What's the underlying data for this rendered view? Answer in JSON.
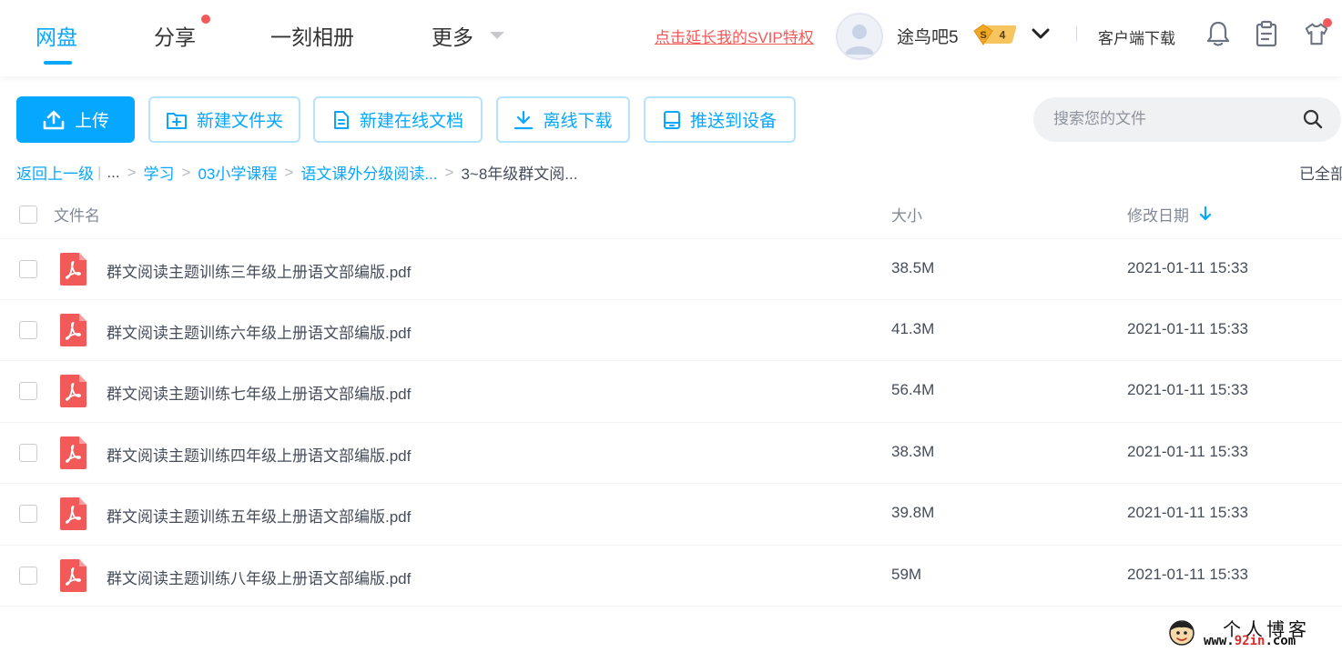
{
  "header": {
    "tabs": [
      {
        "label": "网盘",
        "active": true
      },
      {
        "label": "分享",
        "has_dot": true
      },
      {
        "label": "一刻相册"
      },
      {
        "label": "更多"
      }
    ],
    "svip_link": "点击延长我的SVIP特权",
    "username": "途鸟吧5",
    "vip_badge": {
      "symbol": "S",
      "level": "4"
    },
    "client_download": "客户端下载",
    "icons": [
      "bell-icon",
      "clipboard-icon",
      "tshirt-icon"
    ]
  },
  "toolbar": {
    "upload": "上传",
    "new_folder": "新建文件夹",
    "new_online_doc": "新建在线文档",
    "offline_download": "离线下载",
    "push_to_device": "推送到设备",
    "search_placeholder": "搜索您的文件"
  },
  "breadcrumb": {
    "back": "返回上一级",
    "ellipsis": "...",
    "items": [
      "学习",
      "03小学课程",
      "语文课外分级阅读..."
    ],
    "current": "3~8年级群文阅...",
    "loaded": "已全部"
  },
  "table": {
    "headers": {
      "name": "文件名",
      "size": "大小",
      "modified": "修改日期"
    },
    "sort": "modified-desc",
    "rows": [
      {
        "name": "群文阅读主题训练三年级上册语文部编版.pdf",
        "size": "38.5M",
        "date": "2021-01-11 15:33"
      },
      {
        "name": "群文阅读主题训练六年级上册语文部编版.pdf",
        "size": "41.3M",
        "date": "2021-01-11 15:33"
      },
      {
        "name": "群文阅读主题训练七年级上册语文部编版.pdf",
        "size": "56.4M",
        "date": "2021-01-11 15:33"
      },
      {
        "name": "群文阅读主题训练四年级上册语文部编版.pdf",
        "size": "38.3M",
        "date": "2021-01-11 15:33"
      },
      {
        "name": "群文阅读主题训练五年级上册语文部编版.pdf",
        "size": "39.8M",
        "date": "2021-01-11 15:33"
      },
      {
        "name": "群文阅读主题训练八年级上册语文部编版.pdf",
        "size": "59M",
        "date": "2021-01-11 15:33"
      }
    ]
  },
  "watermark": {
    "title": "个人博客",
    "url_prefix": "www.",
    "url_highlight": "92in",
    "url_suffix": ".com"
  },
  "colors": {
    "accent": "#06a7ff",
    "svip_red": "#f25a5a",
    "pdf_red": "#f25a5a",
    "text": "#454d5a"
  }
}
